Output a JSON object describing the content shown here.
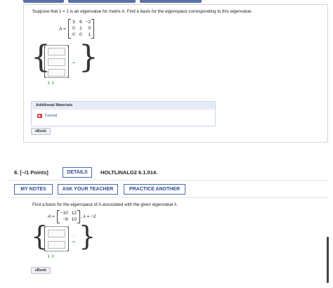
{
  "problem7": {
    "prompt": "Suppose that λ = 1 is an eigenvalue for matrix A. Find a basis for the eigenspace corresponding to this eigenvalue.",
    "matrix_label": "A =",
    "matrix": [
      [
        "3",
        "6",
        "−2"
      ],
      [
        "0",
        "1",
        "0"
      ],
      [
        "0",
        "0",
        "1"
      ]
    ],
    "additional_materials_title": "Additional Materials",
    "tutorial_label": "Tutorial",
    "ebook_label": "eBook",
    "ellipsis": "...."
  },
  "problem8": {
    "number": "8.",
    "points": "[–/1 Points]",
    "details_button": "DETAILS",
    "source": "HOLTLINALG2 6.1.014.",
    "my_notes_button": "MY NOTES",
    "ask_teacher_button": "ASK YOUR TEACHER",
    "practice_button": "PRACTICE ANOTHER",
    "prompt": "Find a basis for the eigenspace of A associated with the given eigenvalue λ.",
    "matrix_label": "A =",
    "matrix": [
      [
        "−10",
        "12"
      ],
      [
        "−8",
        "10"
      ]
    ],
    "eigenvalue": ", λ = −2",
    "ebook_label": "eBook",
    "ellipsis": "...."
  },
  "icons": {
    "add_vector": "arrow-right-icon",
    "sort": "sort-arrows-icon",
    "tutorial": "play-icon"
  },
  "colors": {
    "accent_blue": "#2c4a96",
    "button_border": "#4a68b0",
    "green_icon": "#2a9a3a",
    "tutorial_red": "#d8413b"
  }
}
